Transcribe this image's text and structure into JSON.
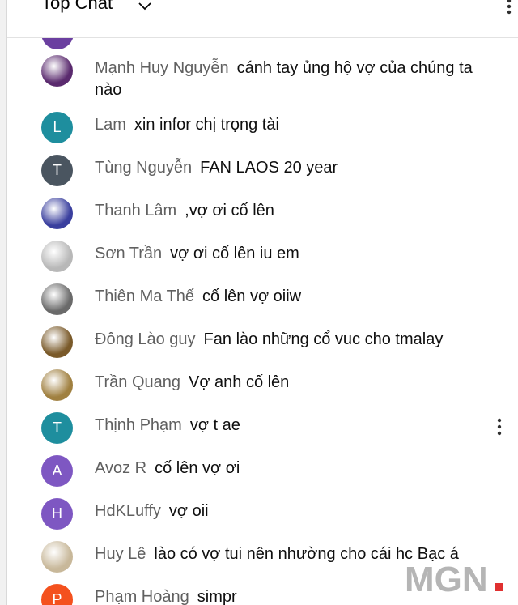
{
  "header": {
    "title": "Top Chat"
  },
  "messages": [
    {
      "author": "Mạnh Huy Nguyễn",
      "text": "cánh tay ủng hộ vợ của chúng ta nào",
      "avatar": "photo",
      "avatar_color": "#5a2a6e"
    },
    {
      "author": "Lam",
      "text": "xin infor chị trọng tài",
      "avatar": "letter",
      "initial": "L",
      "avatar_color": "#1e8e9e"
    },
    {
      "author": "Tùng Nguyễn",
      "text": "FAN LAOS 20 year",
      "avatar": "letter",
      "initial": "T",
      "avatar_color": "#4a5560"
    },
    {
      "author": "Thanh Lâm",
      "text": ",vợ ơi cố lên",
      "avatar": "photo",
      "avatar_color": "#3a3f9e"
    },
    {
      "author": "Sơn Trần",
      "text": "vợ ơi cố lên iu em",
      "avatar": "photo",
      "avatar_color": "#b8b8b8"
    },
    {
      "author": "Thiên Ma Thế",
      "text": "cố lên vợ oiiw",
      "avatar": "photo",
      "avatar_color": "#6a6a6a"
    },
    {
      "author": "Đông Lào guy",
      "text": "Fan lào những cổ vuc cho tmalay",
      "avatar": "photo",
      "avatar_color": "#7a5a2a"
    },
    {
      "author": "Trần Quang",
      "text": "Vợ anh cố lên",
      "avatar": "photo",
      "avatar_color": "#a08040"
    },
    {
      "author": "Thịnh Phạm",
      "text": "vợ t ae",
      "avatar": "letter",
      "initial": "T",
      "avatar_color": "#1e8e9e",
      "show_menu": true
    },
    {
      "author": "Avoz R",
      "text": "cố lên vợ ơi",
      "avatar": "letter",
      "initial": "A",
      "avatar_color": "#7e57c2"
    },
    {
      "author": "HdKLuffy",
      "text": "vợ oii",
      "avatar": "letter",
      "initial": "H",
      "avatar_color": "#7e57c2"
    },
    {
      "author": "Huy Lê",
      "text": "lào có vợ tui nên nhường cho cái hc Bạc á",
      "avatar": "photo",
      "avatar_color": "#c8b89a"
    },
    {
      "author": "Phạm Hoàng",
      "text": "simpr",
      "avatar": "letter",
      "initial": "P",
      "avatar_color": "#f4511e"
    }
  ],
  "watermark": {
    "text": "MGN"
  }
}
